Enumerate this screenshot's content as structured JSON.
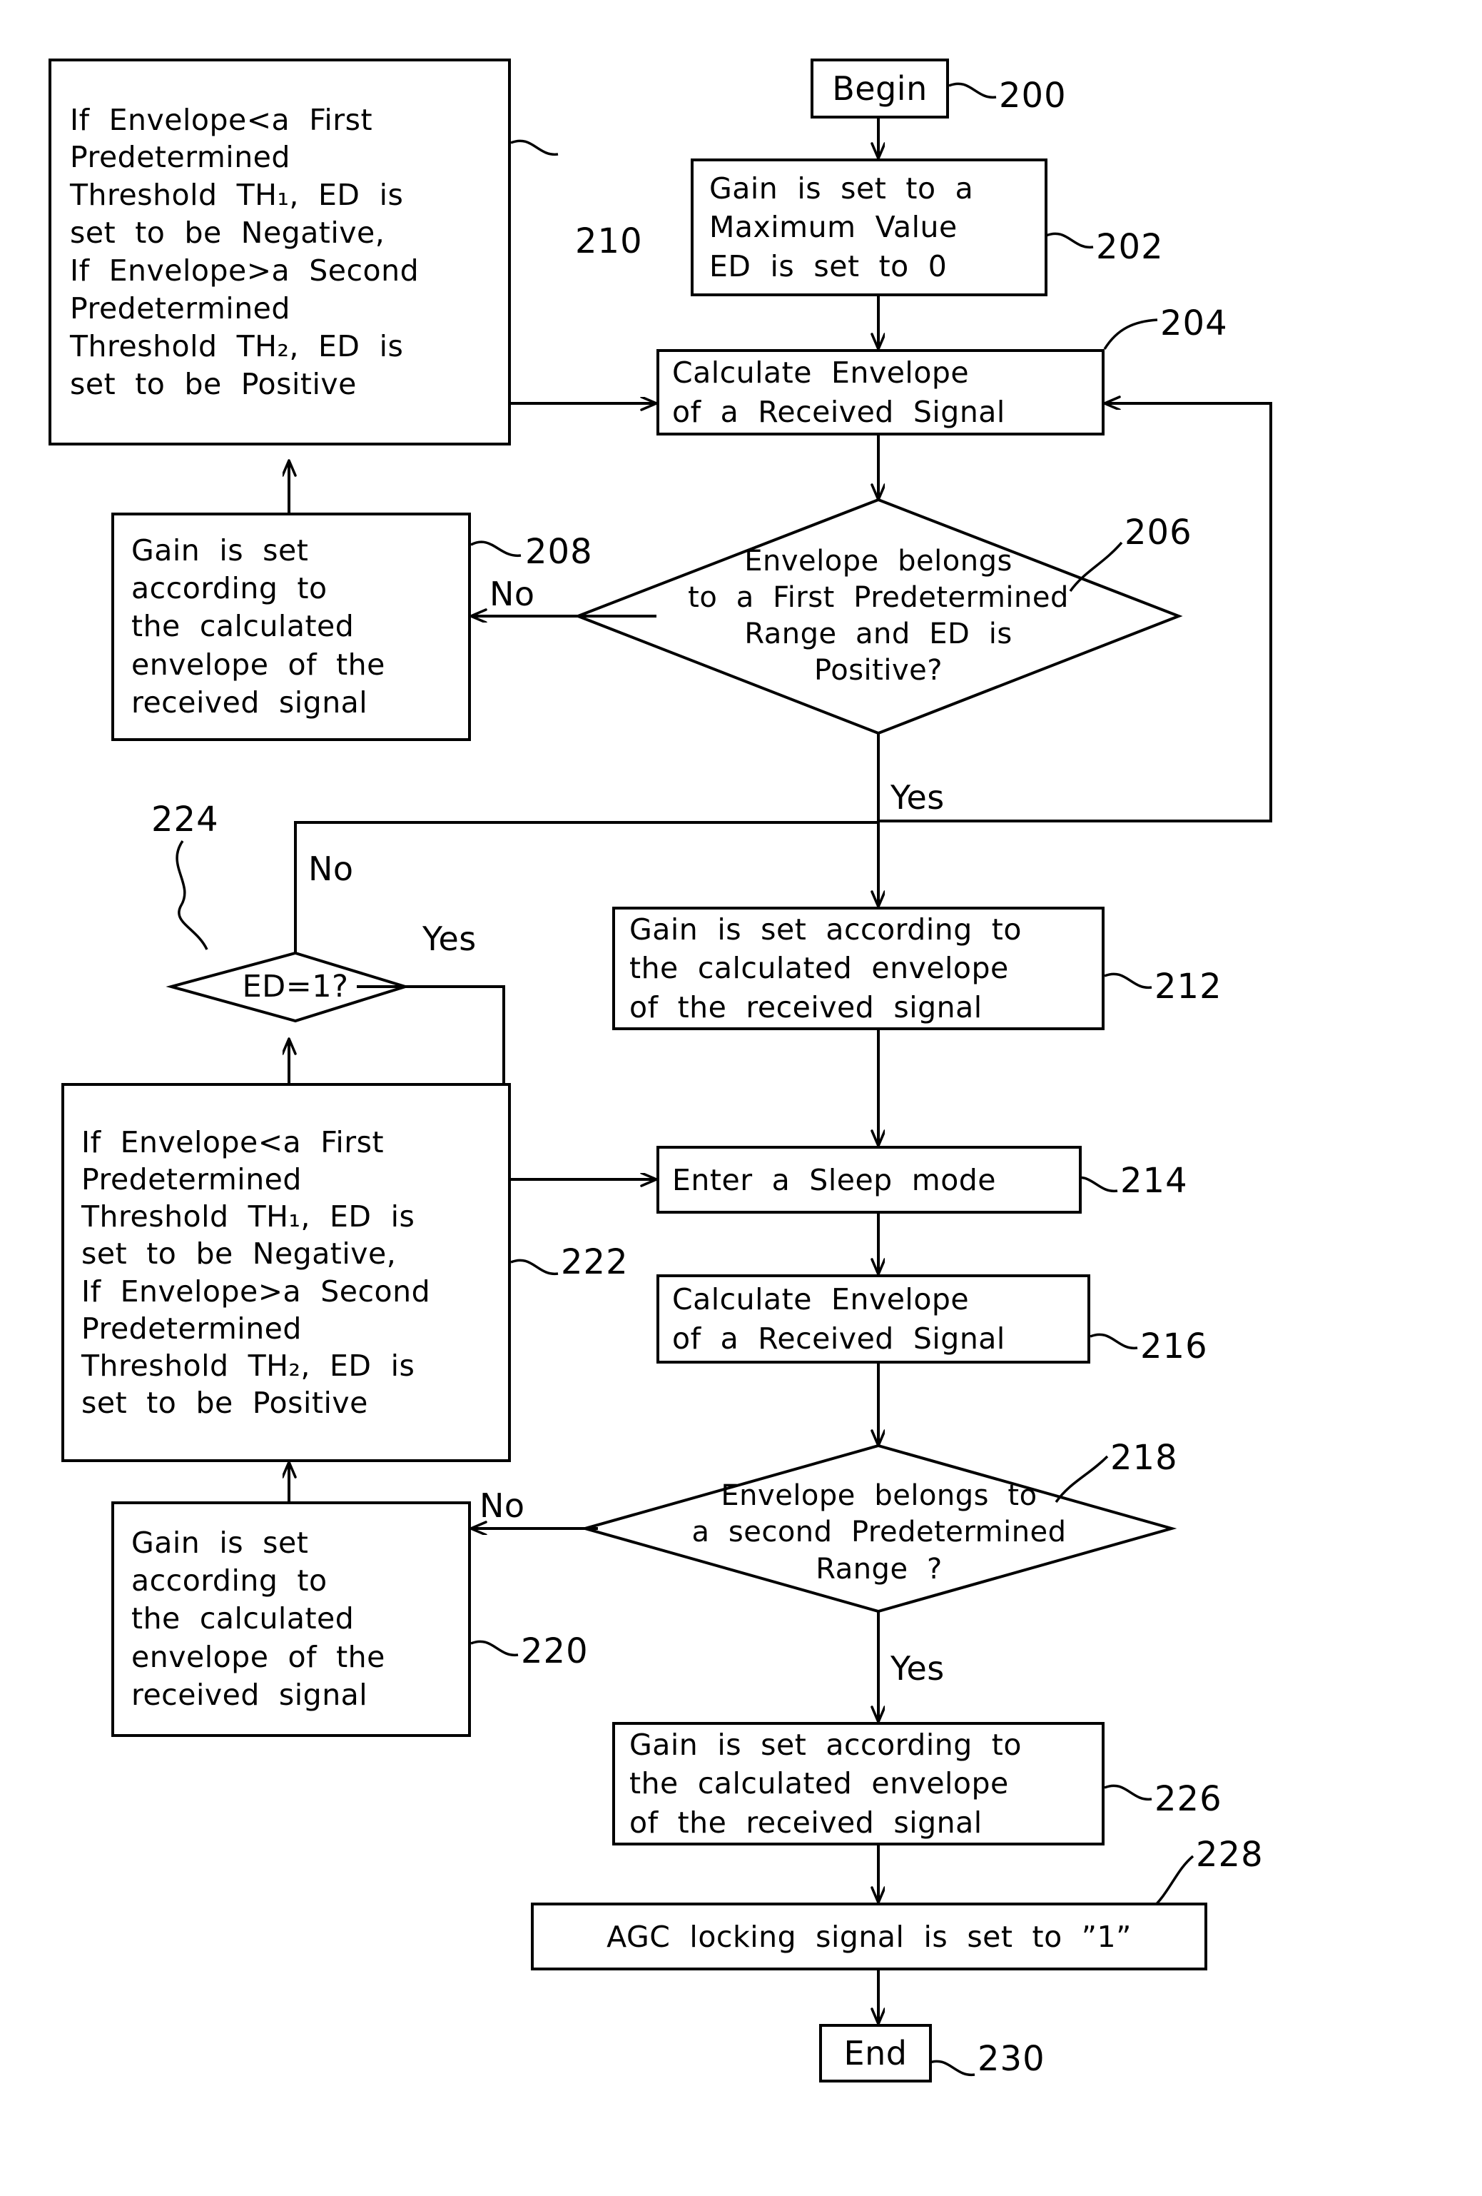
{
  "figure": {
    "type": "patent-flowchart",
    "title": "AGC (Automatic Gain Control) procedure flowchart"
  },
  "nodes": {
    "begin": {
      "ref": "200",
      "shape": "terminal",
      "lines": [
        "Begin"
      ]
    },
    "init_gain": {
      "ref": "202",
      "shape": "process",
      "lines": [
        "Gain  is  set  to  a",
        "Maximum  Value",
        "ED  is  set  to  0"
      ]
    },
    "calc_env_1": {
      "ref": "204",
      "shape": "process",
      "lines": [
        "Calculate  Envelope",
        "of  a  Received  Signal"
      ]
    },
    "decision_1": {
      "ref": "206",
      "shape": "decision",
      "lines": [
        "Envelope  belongs",
        "to  a  First  Predetermined",
        "Range  and  ED  is",
        "Positive?"
      ]
    },
    "gain_set_208": {
      "ref": "208",
      "shape": "process",
      "lines": [
        "Gain  is  set",
        "according  to",
        "the  calculated",
        "envelope  of  the",
        "received  signal"
      ]
    },
    "threshold_210": {
      "ref": "210",
      "shape": "process",
      "lines": [
        "If  Envelope<a  First",
        "Predetermined",
        "Threshold  TH₁,  ED  is",
        "set  to  be  Negative,",
        "If  Envelope>a  Second",
        "Predetermined",
        "Threshold  TH₂,  ED  is",
        "set  to  be  Positive"
      ]
    },
    "gain_set_212": {
      "ref": "212",
      "shape": "process",
      "lines": [
        "Gain  is  set  according  to",
        "the  calculated  envelope",
        "of  the  received  signal"
      ]
    },
    "sleep_214": {
      "ref": "214",
      "shape": "process",
      "lines": [
        "Enter  a  Sleep  mode"
      ]
    },
    "calc_env_2": {
      "ref": "216",
      "shape": "process",
      "lines": [
        "Calculate  Envelope",
        "of  a  Received  Signal"
      ]
    },
    "decision_2": {
      "ref": "218",
      "shape": "decision",
      "lines": [
        "Envelope  belongs  to",
        "a  second  Predetermined",
        "Range  ?"
      ]
    },
    "gain_set_220": {
      "ref": "220",
      "shape": "process",
      "lines": [
        "Gain  is  set",
        "according  to",
        "the  calculated",
        "envelope  of  the",
        "received  signal"
      ]
    },
    "threshold_222": {
      "ref": "222",
      "shape": "process",
      "lines": [
        "If  Envelope<a  First",
        "Predetermined",
        "Threshold  TH₁,  ED  is",
        "set  to  be  Negative,",
        "If  Envelope>a  Second",
        "Predetermined",
        "Threshold  TH₂,  ED  is",
        "set  to  be  Positive"
      ]
    },
    "decision_ed": {
      "ref": "224",
      "shape": "decision",
      "lines": [
        "ED=1?"
      ]
    },
    "gain_set_226": {
      "ref": "226",
      "shape": "process",
      "lines": [
        "Gain  is  set  according  to",
        "the  calculated  envelope",
        "of  the  received  signal"
      ]
    },
    "agc_lock_228": {
      "ref": "228",
      "shape": "process",
      "lines": [
        "AGC  locking  signal  is  set  to  ”1”"
      ]
    },
    "end": {
      "ref": "230",
      "shape": "terminal",
      "lines": [
        "End"
      ]
    }
  },
  "edge_labels": {
    "d1_no": "No",
    "d1_yes": "Yes",
    "ded_no": "No",
    "ded_yes": "Yes",
    "d2_no": "No",
    "d2_yes": "Yes"
  },
  "colors": {
    "stroke": "#000000",
    "background": "#ffffff",
    "text": "#000000"
  }
}
